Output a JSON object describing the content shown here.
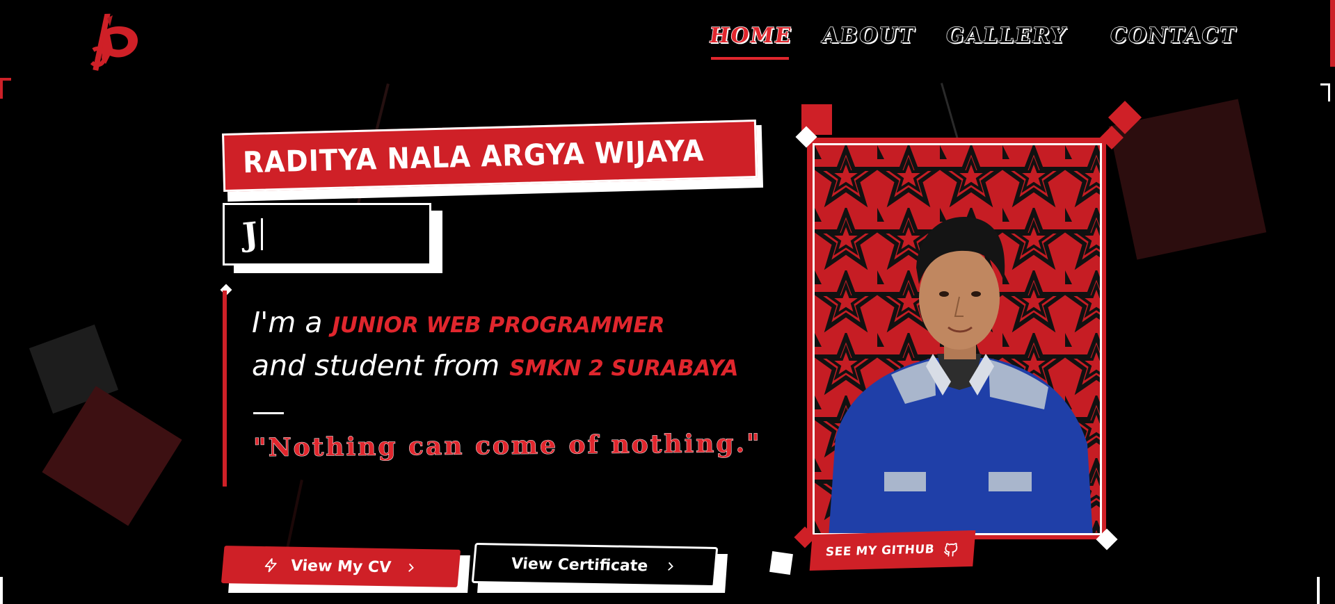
{
  "nav": {
    "items": [
      {
        "label": "HOME",
        "active": true
      },
      {
        "label": "ABOUT",
        "active": false
      },
      {
        "label": "GALLERY",
        "active": false
      },
      {
        "label": "CONTACT",
        "active": false
      }
    ]
  },
  "hero": {
    "name": "RADITYA NALA ARGYA WIJAYA",
    "typed_text": "J",
    "intro": {
      "prefix_1": "I'm a",
      "role": "JUNIOR WEB PROGRAMMER",
      "prefix_2": "and student from",
      "school": "SMKN 2 SURABAYA"
    },
    "quote": "\"Nothing can come of nothing.\""
  },
  "buttons": {
    "cv_label": "View My CV",
    "certificate_label": "View Certificate",
    "github_label": "SEE MY GITHUB"
  },
  "colors": {
    "accent": "#cf2027",
    "background": "#000000",
    "text": "#ffffff"
  },
  "icons": {
    "logo": "logo-mark",
    "cv": "lightning-icon",
    "arrow": "chevron-right-icon",
    "github": "github-icon"
  }
}
